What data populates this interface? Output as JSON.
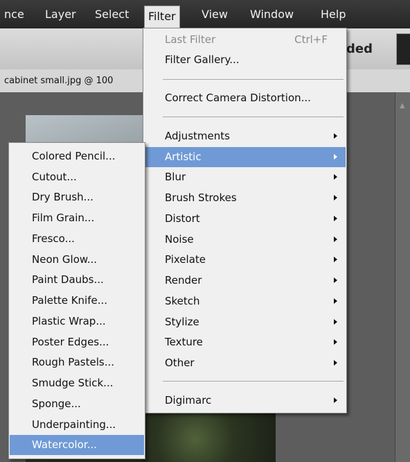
{
  "menubar": {
    "items": [
      "nce",
      "Layer",
      "Select",
      "Filter",
      "View",
      "Window",
      "Help"
    ],
    "open_item": "Filter"
  },
  "options_bar": {
    "mode_label": "ded"
  },
  "document_tab": {
    "title": "cabinet small.jpg @ 100"
  },
  "filter_menu": {
    "last_filter": {
      "label": "Last Filter",
      "shortcut": "Ctrl+F"
    },
    "filter_gallery": "Filter Gallery...",
    "correct_camera_distortion": "Correct Camera Distortion...",
    "submenus": [
      "Adjustments",
      "Artistic",
      "Blur",
      "Brush Strokes",
      "Distort",
      "Noise",
      "Pixelate",
      "Render",
      "Sketch",
      "Stylize",
      "Texture",
      "Other"
    ],
    "highlighted": "Artistic",
    "digimarc": "Digimarc"
  },
  "artistic_submenu": {
    "items": [
      "Colored Pencil...",
      "Cutout...",
      "Dry Brush...",
      "Film Grain...",
      "Fresco...",
      "Neon Glow...",
      "Paint Daubs...",
      "Palette Knife...",
      "Plastic Wrap...",
      "Poster Edges...",
      "Rough Pastels...",
      "Smudge Stick...",
      "Sponge...",
      "Underpainting...",
      "Watercolor..."
    ],
    "highlighted": "Watercolor..."
  },
  "colors": {
    "menubar_bg": "#2f2f2f",
    "menu_bg": "#f0f0f0",
    "highlight": "#6f9ad6",
    "disabled_text": "#8a8a8a"
  }
}
